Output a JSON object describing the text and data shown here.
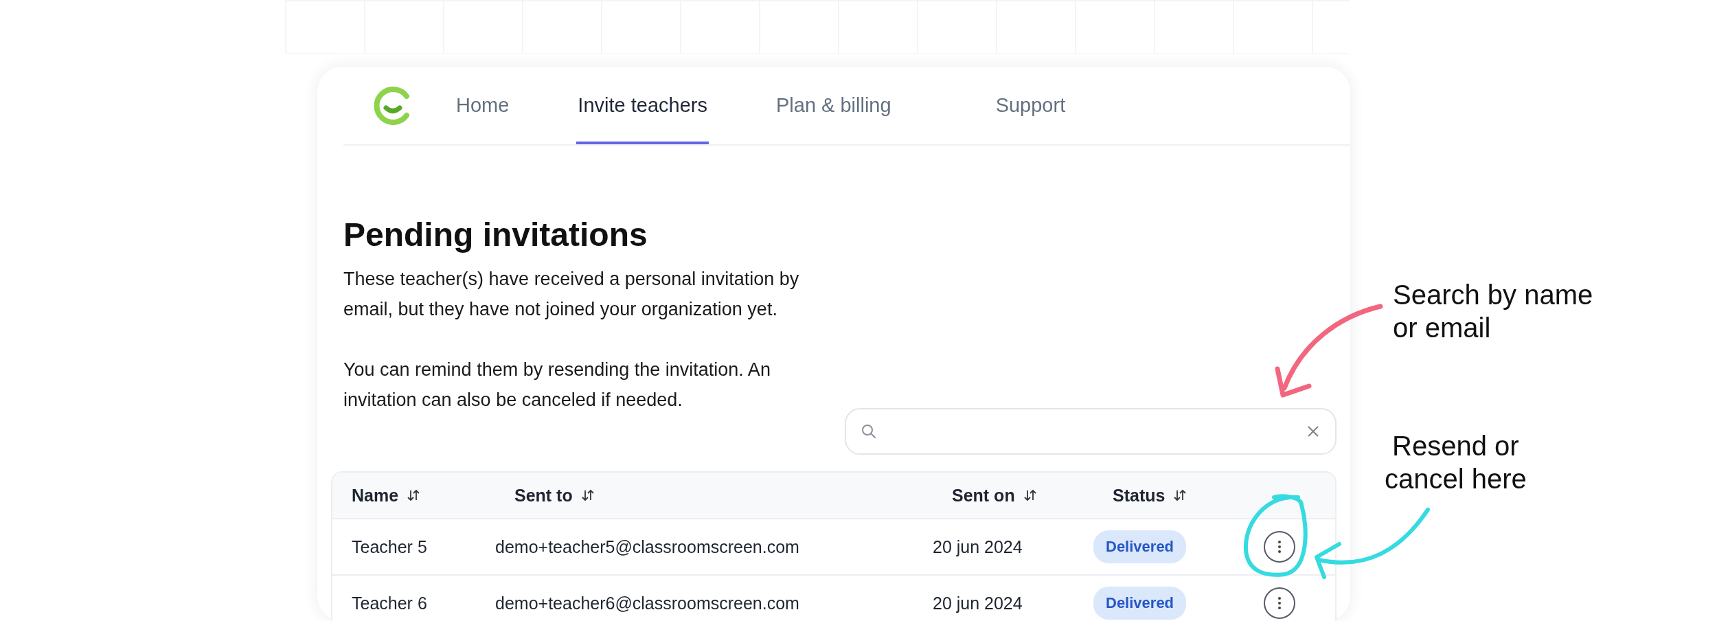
{
  "nav": {
    "items": [
      {
        "label": "Home",
        "selected": false
      },
      {
        "label": "Invite teachers",
        "selected": true
      },
      {
        "label": "Plan & billing",
        "selected": false
      },
      {
        "label": "Support",
        "selected": false
      }
    ]
  },
  "heading": "Pending invitations",
  "paragraphs": [
    "These teacher(s) have received a personal invitation by email, but they have not joined your organization yet.",
    "You can remind them by resending the invitation. An invitation can also be canceled if needed."
  ],
  "table": {
    "columns": [
      {
        "label": "Name",
        "sortable": true
      },
      {
        "label": "Sent to",
        "sortable": true
      },
      {
        "label": "Sent on",
        "sortable": true
      },
      {
        "label": "Status",
        "sortable": true
      }
    ],
    "rows": [
      {
        "name": "Teacher 5",
        "sent_to": "demo+teacher5@classroomscreen.com",
        "sent_on": "20 jun 2024",
        "status": "Delivered"
      },
      {
        "name": "Teacher 6",
        "sent_to": "demo+teacher6@classroomscreen.com",
        "sent_on": "20 jun 2024",
        "status": "Delivered"
      }
    ]
  },
  "annotations": [
    {
      "kind": "search",
      "lines": [
        "Search by name",
        "or email"
      ],
      "color": "#f2667f"
    },
    {
      "kind": "actions",
      "lines": [
        "Resend or",
        "cancel here"
      ],
      "color": "#35dbe0"
    }
  ]
}
